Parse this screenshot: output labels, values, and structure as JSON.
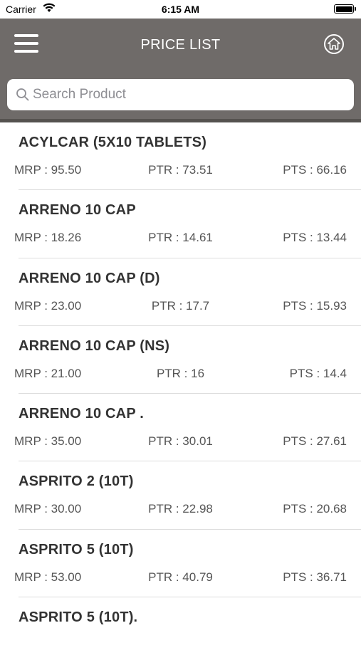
{
  "status": {
    "carrier": "Carrier",
    "time": "6:15 AM"
  },
  "header": {
    "title": "PRICE LIST",
    "menu_icon": "hamburger-menu-icon",
    "home_icon": "home-icon"
  },
  "search": {
    "placeholder": "Search Product",
    "value": ""
  },
  "colors": {
    "header_bg": "#6f6b69",
    "text": "#333333"
  },
  "products": [
    {
      "name": "ACYLCAR (5X10 TABLETS)",
      "mrp": "MRP : 95.50",
      "ptr": "PTR : 73.51",
      "pts": "PTS : 66.16"
    },
    {
      "name": "ARRENO 10 CAP",
      "mrp": "MRP : 18.26",
      "ptr": "PTR : 14.61",
      "pts": "PTS : 13.44"
    },
    {
      "name": "ARRENO 10 CAP (D)",
      "mrp": "MRP : 23.00",
      "ptr": "PTR : 17.7",
      "pts": "PTS : 15.93"
    },
    {
      "name": "ARRENO 10 CAP (NS)",
      "mrp": "MRP : 21.00",
      "ptr": "PTR : 16",
      "pts": "PTS : 14.4"
    },
    {
      "name": "ARRENO 10 CAP .",
      "mrp": "MRP : 35.00",
      "ptr": "PTR : 30.01",
      "pts": "PTS : 27.61"
    },
    {
      "name": "ASPRITO 2 (10T)",
      "mrp": "MRP : 30.00",
      "ptr": "PTR : 22.98",
      "pts": "PTS : 20.68"
    },
    {
      "name": "ASPRITO 5 (10T)",
      "mrp": "MRP : 53.00",
      "ptr": "PTR : 40.79",
      "pts": "PTS : 36.71"
    },
    {
      "name": "ASPRITO 5 (10T).",
      "mrp": "",
      "ptr": "",
      "pts": ""
    }
  ]
}
